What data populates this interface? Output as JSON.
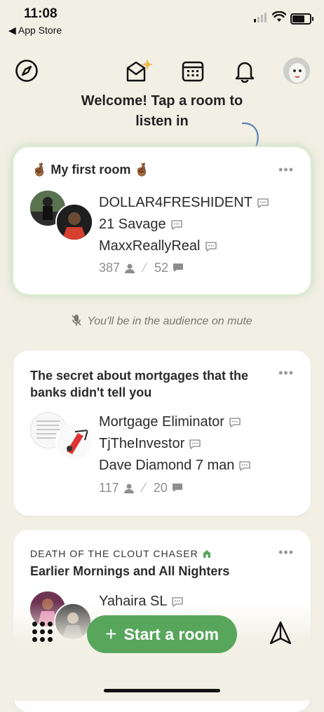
{
  "status_bar": {
    "time": "11:08",
    "back_label": "◀ App Store"
  },
  "welcome": {
    "text": "Welcome! Tap a room to listen in"
  },
  "rooms": [
    {
      "club": "",
      "title": "🤞🏾 My first room 🤞🏾",
      "speakers": [
        "DOLLAR4FRESHIDENT",
        "21 Savage",
        "MaxxReallyReal"
      ],
      "listeners": "387",
      "chatters": "52"
    },
    {
      "club": "",
      "title": "The secret about mortgages that the banks didn't tell you",
      "speakers": [
        "Mortgage Eliminator",
        "TjTheInvestor",
        "Dave Diamond 7 man"
      ],
      "listeners": "117",
      "chatters": "20"
    },
    {
      "club": "DEATH OF THE CLOUT CHASER",
      "title": "Earlier Mornings and All Nighters",
      "speakers": [
        "Yahaira SL"
      ],
      "listeners": "",
      "chatters": ""
    }
  ],
  "audience_note": "You'll be in the audience on mute",
  "start_button": {
    "label": "Start a room",
    "icon": "+"
  },
  "colors": {
    "background": "#f2efe4",
    "accent_green": "#58a65c",
    "card": "#ffffff"
  },
  "icons": [
    "explore-icon",
    "invite-envelope-icon",
    "calendar-icon",
    "notification-bell-icon",
    "profile-avatar",
    "grid-dots-icon",
    "send-icon"
  ]
}
